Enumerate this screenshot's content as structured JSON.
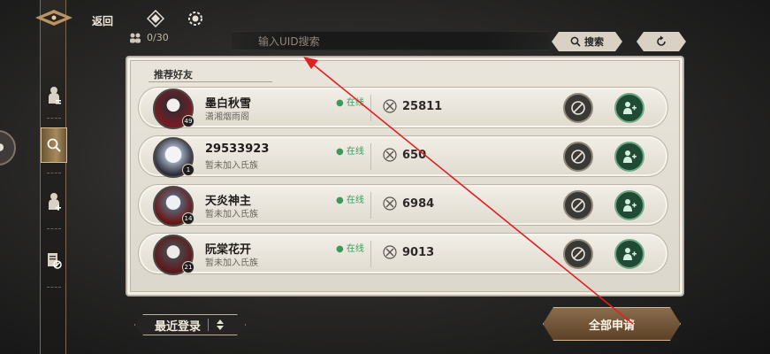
{
  "header": {
    "back_label": "返回",
    "friend_count": "0/30"
  },
  "search": {
    "placeholder": "输入UID搜索",
    "button_label": "搜索"
  },
  "panel": {
    "title": "推荐好友"
  },
  "friends": [
    {
      "name": "墨白秋雪",
      "clan": "潇湘烟雨阁",
      "status": "在线",
      "power": "25811",
      "level": "49"
    },
    {
      "name": "29533923",
      "clan": "暂未加入氏族",
      "status": "在线",
      "power": "650",
      "level": "1"
    },
    {
      "name": "天炎神主",
      "clan": "暂未加入氏族",
      "status": "在线",
      "power": "6984",
      "level": "14"
    },
    {
      "name": "阮棠花开",
      "clan": "暂未加入氏族",
      "status": "在线",
      "power": "9013",
      "level": "21"
    }
  ],
  "footer": {
    "sort_label": "最近登录",
    "apply_all_label": "全部申请"
  },
  "colors": {
    "online": "#3a9a5b",
    "add_button": "#214a35",
    "annotation_arrow": "#e02020"
  }
}
